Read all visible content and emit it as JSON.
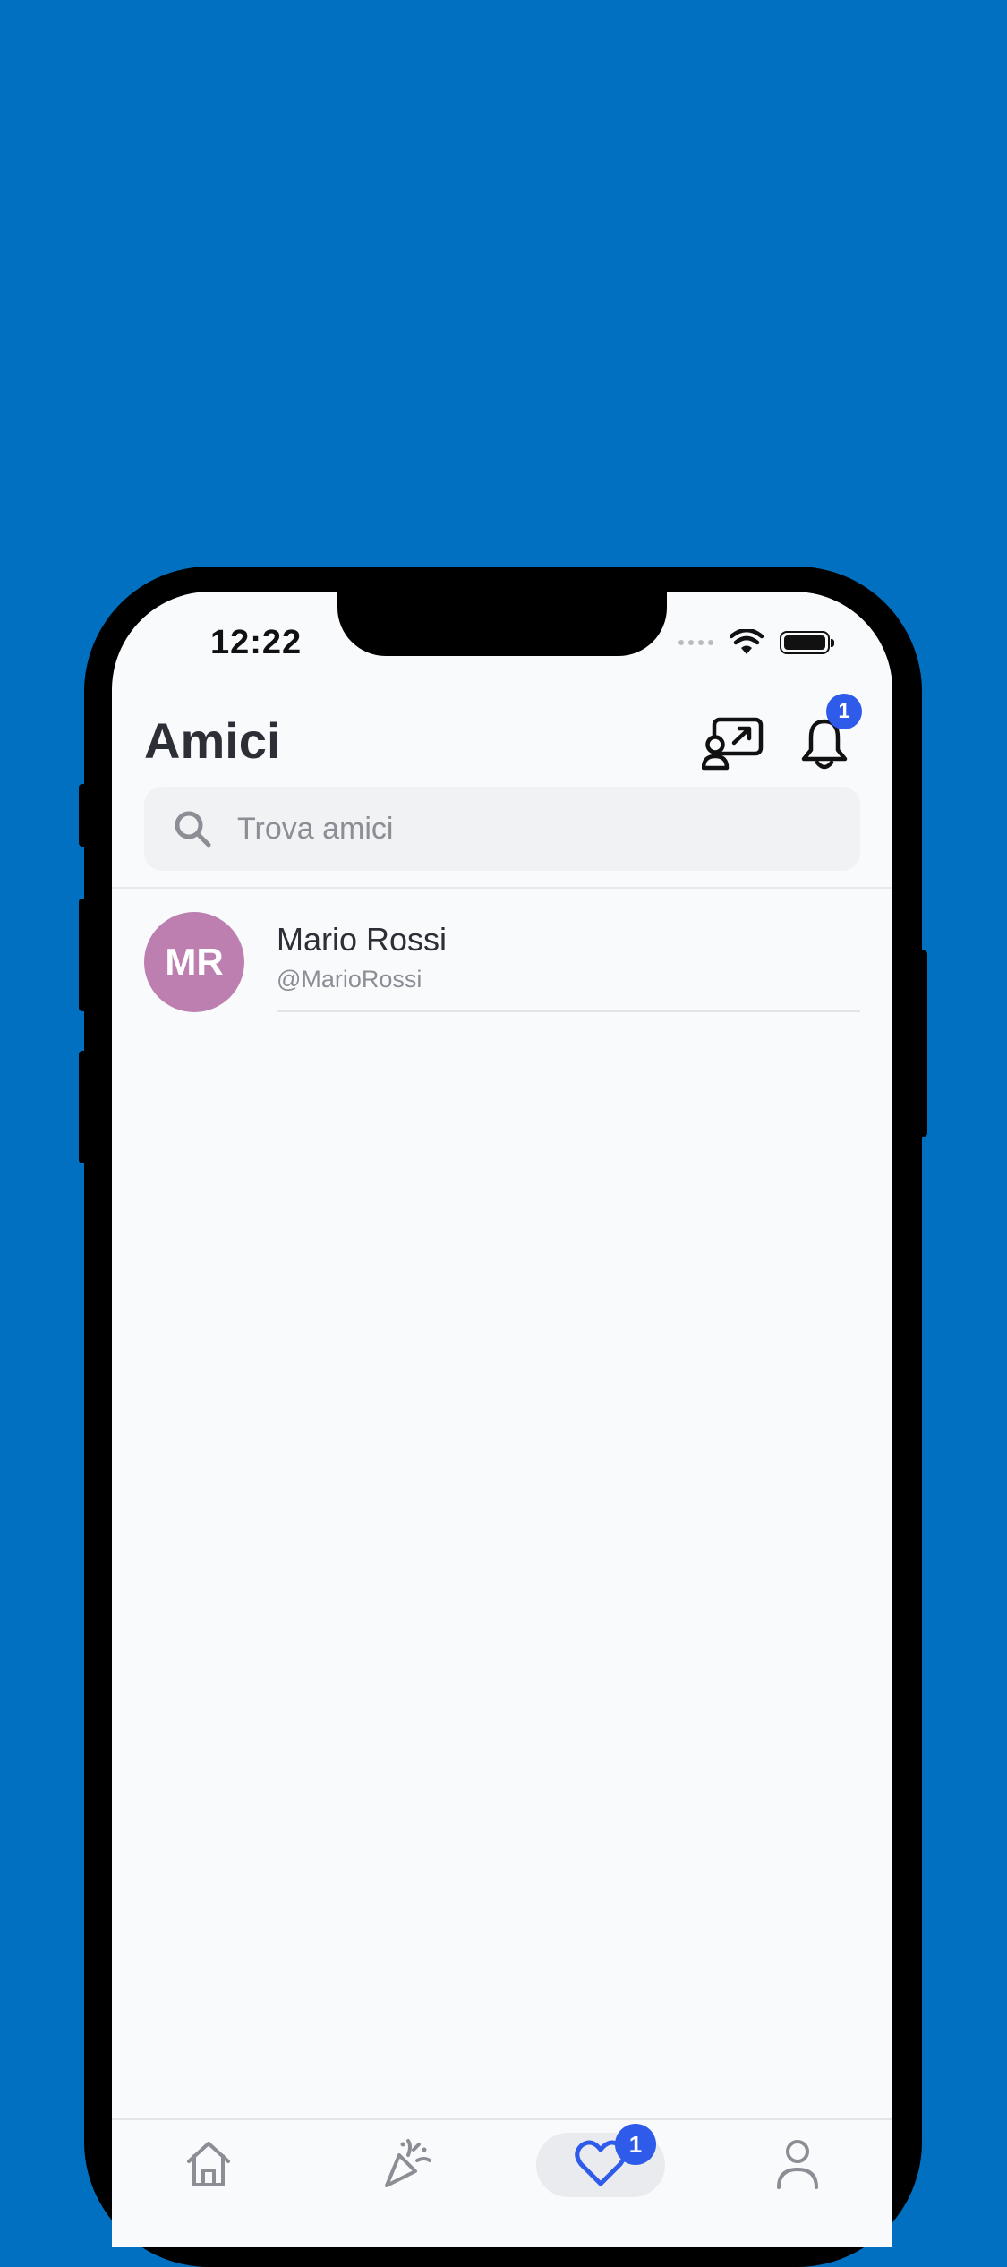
{
  "status_bar": {
    "time": "12:22"
  },
  "header": {
    "title": "Amici",
    "notification_count": "1"
  },
  "search": {
    "placeholder": "Trova amici"
  },
  "friends": [
    {
      "initials": "MR",
      "name": "Mario Rossi",
      "handle": "@MarioRossi",
      "avatar_color": "#BC7FB0"
    }
  ],
  "tab_bar": {
    "items": [
      {
        "icon": "home-icon"
      },
      {
        "icon": "party-popper-icon"
      },
      {
        "icon": "heart-icon",
        "active": true,
        "badge": "1"
      },
      {
        "icon": "person-icon"
      }
    ]
  },
  "colors": {
    "background": "#0270C1",
    "accent": "#2F5BEA",
    "screen": "#F9FAFC"
  }
}
